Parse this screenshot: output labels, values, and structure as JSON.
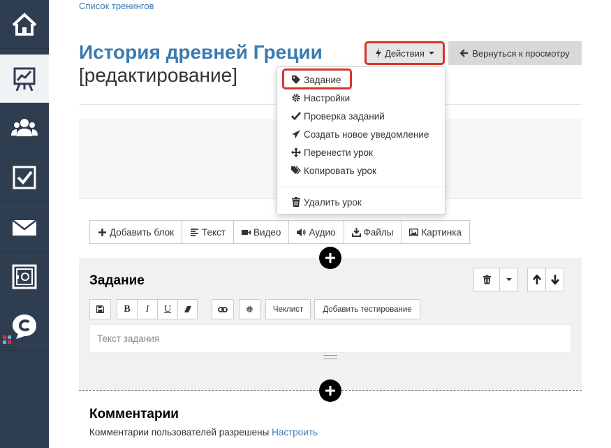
{
  "sidebar": {
    "items": [
      {
        "icon": "home-icon"
      },
      {
        "icon": "chart-board-icon",
        "active": true
      },
      {
        "icon": "users-icon"
      },
      {
        "icon": "checkbox-icon"
      },
      {
        "icon": "mail-icon"
      },
      {
        "icon": "safe-icon"
      },
      {
        "icon": "chat-c-icon"
      }
    ]
  },
  "breadcrumb": {
    "label": "Список тренингов"
  },
  "page": {
    "title": "История древней Греции",
    "subtitle": "[редактирование]"
  },
  "header": {
    "actions_label": "Действия",
    "back_label": "Вернуться к просмотру"
  },
  "actions_menu": {
    "items": [
      {
        "label": "Задание",
        "icon": "tag-icon"
      },
      {
        "label": "Настройки",
        "icon": "gear-icon"
      },
      {
        "label": "Проверка заданий",
        "icon": "check-icon"
      },
      {
        "label": "Создать новое уведомление",
        "icon": "send-icon"
      },
      {
        "label": "Перенести урок",
        "icon": "move-icon"
      },
      {
        "label": "Копировать урок",
        "icon": "tags-icon"
      }
    ],
    "delete_label": "Удалить урок"
  },
  "toolbar": {
    "items": [
      {
        "label": "Добавить блок",
        "icon": "plus-icon"
      },
      {
        "label": "Текст",
        "icon": "align-left-icon"
      },
      {
        "label": "Видео",
        "icon": "video-icon"
      },
      {
        "label": "Аудио",
        "icon": "volume-icon"
      },
      {
        "label": "Файлы",
        "icon": "download-icon"
      },
      {
        "label": "Картинка",
        "icon": "image-icon"
      }
    ]
  },
  "block": {
    "title": "Задание",
    "format_buttons": [
      "save-icon",
      "B",
      "I",
      "U",
      "eraser-icon"
    ],
    "checklist_label": "Чеклист",
    "add_test_label": "Добавить тестирование",
    "text_placeholder": "Текст задания"
  },
  "comments": {
    "title": "Комментарии",
    "text": "Комментарии пользователей разрешены",
    "link": "Настроить"
  },
  "colors": {
    "sidebar": "#2e3e50",
    "accent": "#3c7ab0",
    "highlight": "#d9342b"
  }
}
